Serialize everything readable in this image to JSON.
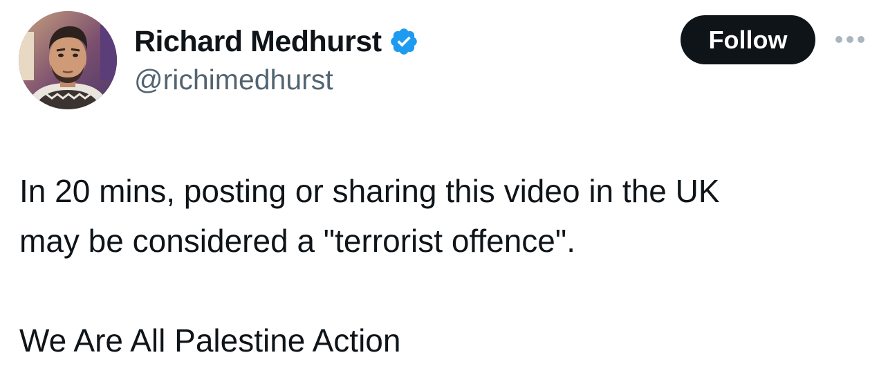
{
  "author": {
    "display_name": "Richard Medhurst",
    "handle": "@richimedhurst",
    "verified": true,
    "avatar_icon": "profile-photo-avatar"
  },
  "actions": {
    "follow_label": "Follow",
    "more_icon": "more-horizontal-icon"
  },
  "tweet": {
    "line1": "In 20 mins, posting or sharing this video in the UK",
    "line2": "may be considered a \"terrorist offence\".",
    "line3": "We Are All Palestine Action"
  },
  "colors": {
    "text_primary": "#0f1419",
    "text_secondary": "#536471",
    "verified_blue": "#1d9bf0",
    "follow_bg": "#0f1419",
    "follow_text": "#ffffff",
    "more_dots": "#a9b5bf"
  }
}
